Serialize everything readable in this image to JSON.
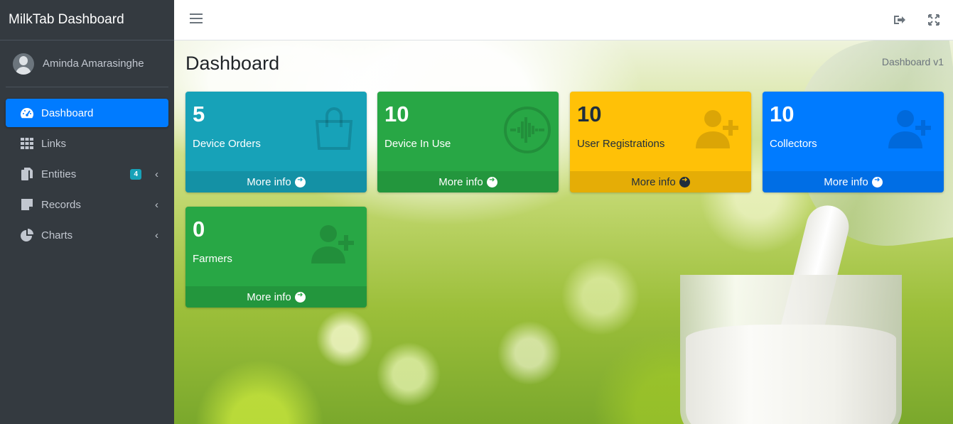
{
  "brand": {
    "title": "MilkTab Dashboard"
  },
  "user": {
    "name": "Aminda Amarasinghe"
  },
  "sidebar": {
    "items": [
      {
        "label": "Dashboard",
        "icon": "tachometer-icon",
        "active": true
      },
      {
        "label": "Links",
        "icon": "grid-icon"
      },
      {
        "label": "Entities",
        "icon": "copy-icon",
        "badge": "4"
      },
      {
        "label": "Records",
        "icon": "note-icon"
      },
      {
        "label": "Charts",
        "icon": "pie-chart-icon"
      }
    ]
  },
  "header": {
    "title": "Dashboard",
    "breadcrumb": "Dashboard v1"
  },
  "boxes": [
    {
      "value": "5",
      "label": "Device Orders",
      "footer": "More info",
      "color": "#17a2b8",
      "icon": "shopping-bag-icon"
    },
    {
      "value": "10",
      "label": "Device In Use",
      "footer": "More info",
      "color": "#28a745",
      "icon": "audio-wave-icon"
    },
    {
      "value": "10",
      "label": "User Registrations",
      "footer": "More info",
      "color": "#ffc107",
      "icon": "user-plus-icon"
    },
    {
      "value": "10",
      "label": "Collectors",
      "footer": "More info",
      "color": "#007bff",
      "icon": "user-plus-icon"
    },
    {
      "value": "0",
      "label": "Farmers",
      "footer": "More info",
      "color": "#28a745",
      "icon": "user-plus-icon"
    }
  ]
}
